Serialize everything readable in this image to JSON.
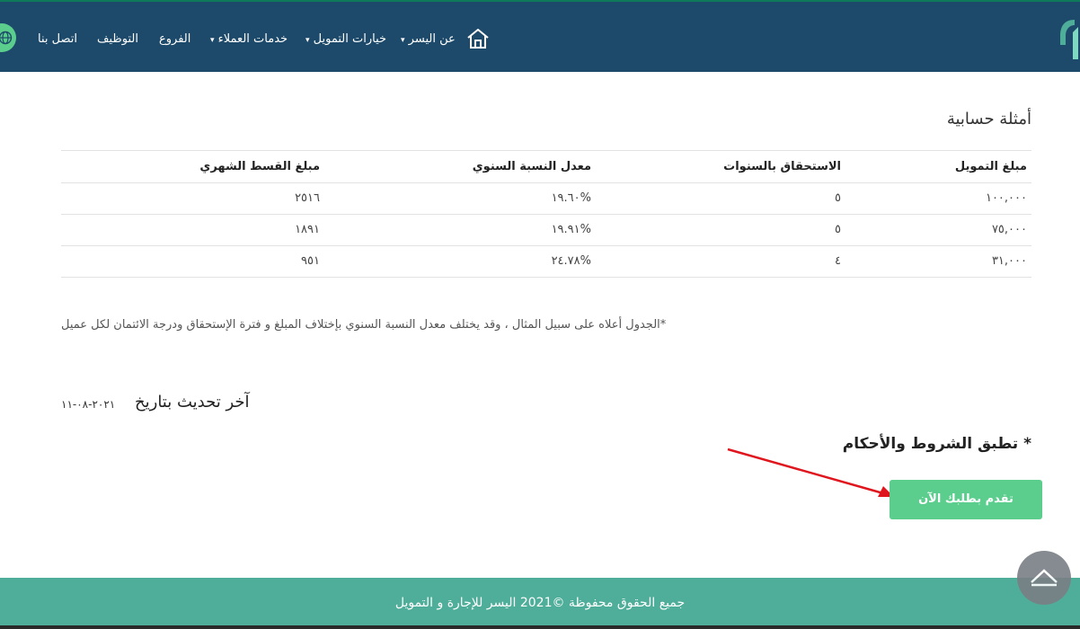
{
  "nav": {
    "items": [
      {
        "label": "اتصل بنا",
        "caret": false
      },
      {
        "label": "التوظيف",
        "caret": false
      },
      {
        "label": "الفروع",
        "caret": false
      },
      {
        "label": "خدمات العملاء",
        "caret": true
      },
      {
        "label": "خيارات التمويل",
        "caret": true
      },
      {
        "label": "عن اليسر",
        "caret": true
      }
    ],
    "home_icon": "home-icon",
    "language_icon": "globe-icon"
  },
  "section": {
    "title": "أمثلة حسابية"
  },
  "table": {
    "headers": [
      "مبلغ التمويل",
      "الاستحقاق بالسنوات",
      "معدل النسبة السنوي",
      "مبلغ القسط الشهري"
    ],
    "rows": [
      [
        "١٠٠,٠٠٠",
        "٥",
        "١٩.٦٠%",
        "٢٥١٦"
      ],
      [
        "٧٥,٠٠٠",
        "٥",
        "١٩.٩١%",
        "١٨٩١"
      ],
      [
        "٣١,٠٠٠",
        "٤",
        "٢٤.٧٨%",
        "٩٥١"
      ]
    ]
  },
  "note": "*الجدول أعلاه على سبيل المثال ، وقد يختلف معدل النسبة السنوي بإختلاف المبلغ و فترة الإستحقاق ودرجة الائتمان لكل عميل",
  "update": {
    "label": "آخر تحديث بتاريخ",
    "date": "٢٠٢١-٠٨-١١"
  },
  "terms": "* تطبق الشروط والأحكام",
  "cta": {
    "label": "تقدم بطلبك الآن"
  },
  "footer": {
    "text": "جميع الحقوق محفوظة ©2021 اليسر للإجارة و التمويل"
  },
  "colors": {
    "header_bg": "#1d4a6a",
    "accent_green": "#5bce8e",
    "footer_bg": "#4fae9a",
    "annotation_arrow": "#e0161e"
  }
}
